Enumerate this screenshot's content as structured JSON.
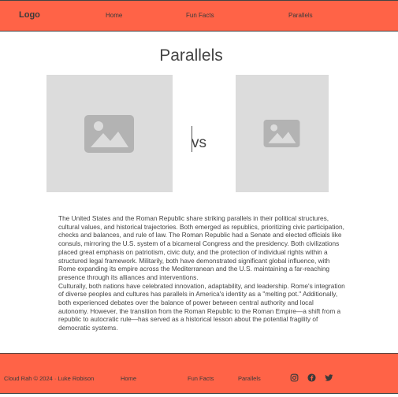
{
  "header": {
    "logo": "Logo",
    "nav": [
      "Home",
      "Fun Facts",
      "Parallels"
    ]
  },
  "main": {
    "title": "Parallels",
    "vs_label": "vs",
    "images": [
      {
        "icon": "image-placeholder-icon"
      },
      {
        "icon": "image-placeholder-icon"
      }
    ],
    "paragraphs": [
      " The United States and the Roman Republic share striking parallels in their political structures, cultural values, and historical trajectories. Both emerged as republics, prioritizing civic participation, checks and balances, and rule of law. The Roman Republic had a Senate and elected officials like consuls, mirroring the U.S. system of a bicameral Congress and the presidency. Both civilizations placed great emphasis on patriotism, civic duty, and the protection of individual rights within a structured legal framework. Militarily, both have demonstrated significant global influence, with Rome expanding its empire across the Mediterranean and the U.S. maintaining a far-reaching presence through its alliances and interventions.",
      "Culturally, both nations have celebrated innovation, adaptability, and leadership. Rome's integration of diverse peoples and cultures has parallels in America's identity as a \"melting pot.\" Additionally, both experienced debates over the balance of power between central authority and local autonomy. However, the transition from the Roman Republic to the Roman Empire—a shift from a republic to autocratic rule—has served as a historical lesson about the potential fragility of democratic systems."
    ]
  },
  "footer": {
    "copyright": "Cloud Rah © 2024 · Luke Robison",
    "nav": [
      "Home",
      "Fun Facts",
      "Parallels"
    ],
    "social_icons": [
      "instagram-icon",
      "facebook-icon",
      "twitter-icon"
    ]
  },
  "colors": {
    "accent": "#ff6347",
    "placeholder": "#dcdcdc",
    "placeholder_icon": "#b3b3b3",
    "text": "#444444"
  }
}
